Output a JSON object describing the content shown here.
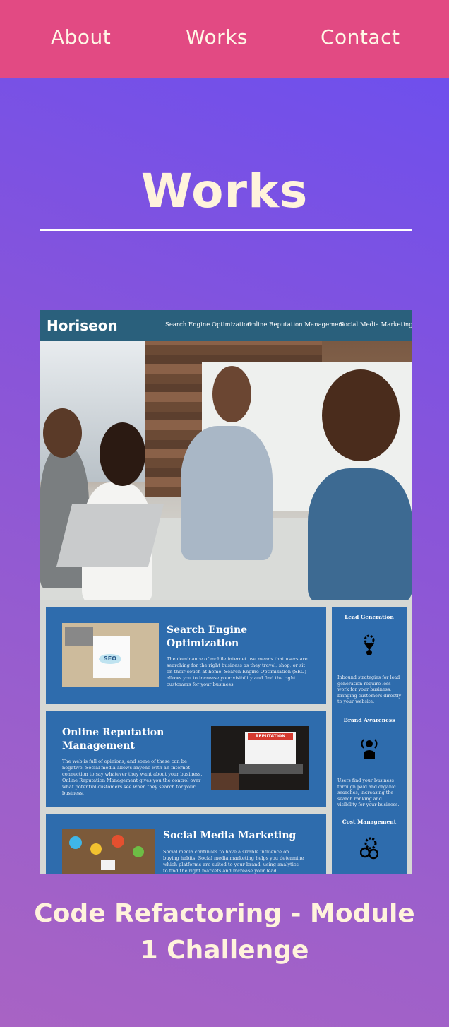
{
  "nav": {
    "items": [
      "About",
      "Works",
      "Contact"
    ]
  },
  "section": {
    "title": "Works"
  },
  "project": {
    "screenshot": {
      "logo": "Horiseon",
      "nav": [
        "Search Engine Optimization",
        "Online Reputation Management",
        "Social Media Marketing"
      ],
      "cards": [
        {
          "title": "Search Engine Optimization",
          "text": "The dominance of mobile internet use means that users are searching for the right business as they travel, shop, or sit on their couch at home. Search Engine Optimization (SEO) allows you to increase your visibility and find the right customers for your business."
        },
        {
          "title": "Online Reputation Management",
          "text": "The web is full of opinions, and some of these can be negative. Social media allows anyone with an internet connection to say whatever they want about your business. Online Reputation Management gives you the control over what potential customers see when they search for your business."
        },
        {
          "title": "Social Media Marketing",
          "text": "Social media continues to have a sizable influence on buying habits. Social media marketing helps you determine which platforms are suited to your brand, using analytics to find the right markets and increase your lead generation."
        }
      ],
      "aside": [
        {
          "title": "Lead Generation",
          "text": "Inbound strategies for lead generation require less work for your business, bringing customers directly to your website."
        },
        {
          "title": "Brand Awareness",
          "text": "Users find your business through paid and organic searches, increasing the search ranking and visibility for your business."
        },
        {
          "title": "Cost Management",
          "text": ""
        }
      ],
      "thumb_labels": {
        "seo": "SEO",
        "reputation": "REPUTATION"
      }
    },
    "caption": "Code Refactoring - Module 1 Challenge"
  },
  "colors": {
    "nav_bg": "#e24a83",
    "title_text": "#fff3dc",
    "card_blue": "#2e6cad",
    "header_teal": "#2a607c"
  }
}
